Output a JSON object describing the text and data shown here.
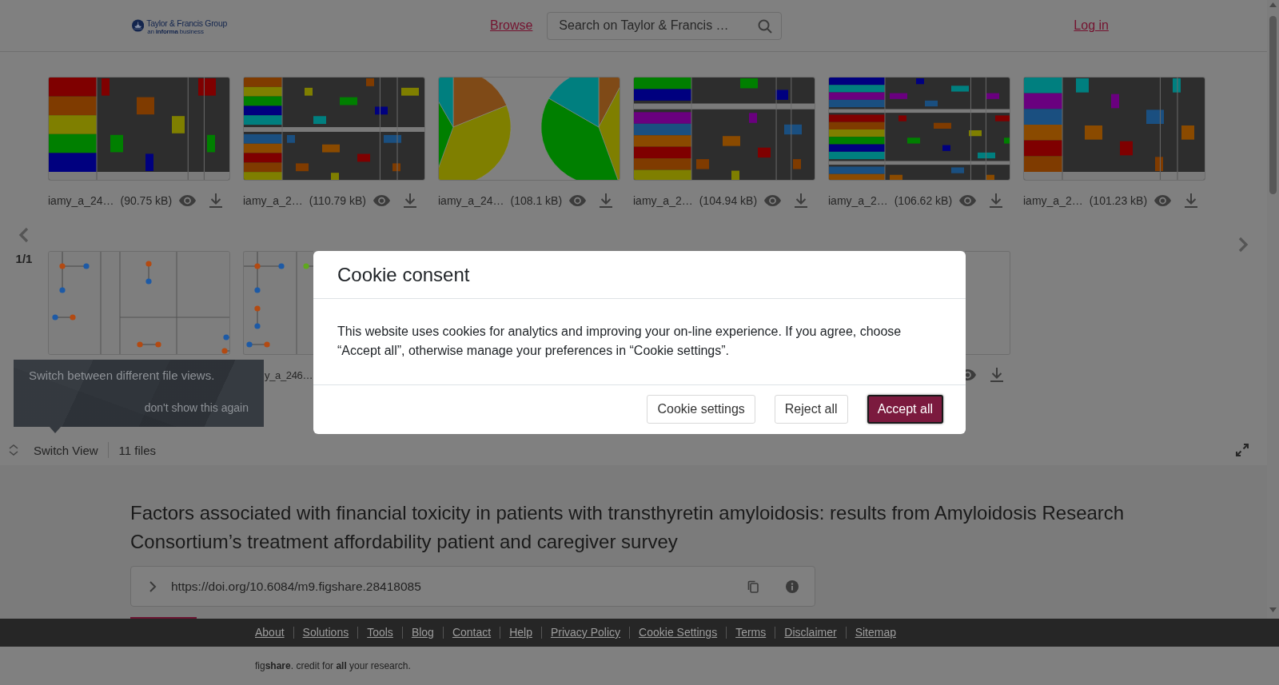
{
  "header": {
    "logo_name": "Taylor & Francis Group",
    "logo_tagline": "an **informa** business",
    "browse_link": "Browse",
    "search": {
      "placeholder": "Search on Taylor & Francis …"
    },
    "login_link": "Log in"
  },
  "file_viewer": {
    "page_indicator": "1/1",
    "rows": [
      {
        "files": [
          {
            "kind": "heatmap",
            "name": "iamy_a_24…",
            "size": "(90.75 kB)",
            "actions_visible": true
          },
          {
            "kind": "heatmap",
            "name": "iamy_a_2…",
            "size": "(110.79 kB)",
            "actions_visible": true
          },
          {
            "kind": "pie",
            "name": "iamy_a_24…",
            "size": "(108.1 kB)",
            "actions_visible": true
          },
          {
            "kind": "heatmap",
            "name": "iamy_a_2…",
            "size": "(104.94 kB)",
            "actions_visible": true
          },
          {
            "kind": "heatmap",
            "name": "iamy_a_2…",
            "size": "(106.62 kB)",
            "actions_visible": true
          },
          {
            "kind": "heatmap",
            "name": "iamy_a_2…",
            "size": "(101.23 kB)",
            "actions_visible": true
          }
        ]
      },
      {
        "files": [
          {
            "kind": "dot-diagram",
            "actions_visible": false
          },
          {
            "kind": "dot-diagram",
            "name": "y_a_246…",
            "actions_visible": false
          },
          {
            "kind": "blank",
            "actions_visible": true
          }
        ]
      }
    ],
    "switch_view": "Switch View",
    "file_count": "11 files"
  },
  "tooltip": {
    "text": "Switch between different file views.",
    "dismiss_link": "don't show this again"
  },
  "article": {
    "title": "Factors associated with financial toxicity in patients with transthyretin amyloidosis: results from Amyloidosis Research Consortium’s treatment affordability patient and caregiver survey",
    "doi": "https://doi.org/10.6084/m9.figshare.28418085"
  },
  "footer": {
    "links": [
      "About",
      "Solutions",
      "Tools",
      "Blog",
      "Contact",
      "Help",
      "Privacy Policy",
      "Cookie Settings",
      "Terms",
      "Disclaimer",
      "Sitemap"
    ],
    "tagline": "fig**share**. credit for **all** your research."
  },
  "cookie_dialog": {
    "title": "Cookie consent",
    "message": "This website uses cookies for analytics and improving your on-line experience. If you agree, choose “Accept all”, otherwise manage your preferences in “Cookie settings”.",
    "buttons": [
      {
        "label": "Cookie settings",
        "kind": "secondary"
      },
      {
        "label": "Reject all",
        "kind": "secondary"
      },
      {
        "label": "Accept all",
        "kind": "primary"
      }
    ]
  }
}
